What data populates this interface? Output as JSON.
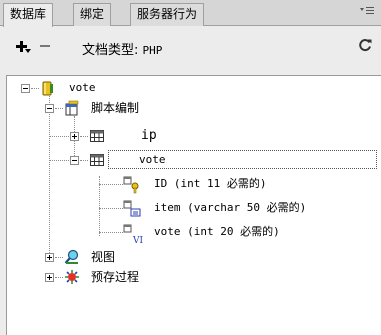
{
  "tabs": [
    {
      "label": "数据库",
      "active": true
    },
    {
      "label": "绑定",
      "active": false
    },
    {
      "label": "服务器行为",
      "active": false
    }
  ],
  "panel_menu_icon": "options-menu-icon",
  "toolbar": {
    "add_icon": "plus-dropdown-icon",
    "remove_icon": "minus-icon",
    "doc_type_label": "文档类型:",
    "doc_type_value": "PHP",
    "refresh_icon": "refresh-icon"
  },
  "tree": {
    "root": {
      "label": "vote",
      "icon": "database-cylinder-icon"
    },
    "scripts": {
      "label": "脚本编制",
      "icon": "table-folder-icon"
    },
    "tables": [
      {
        "label": "ip",
        "icon": "table-grid-icon",
        "expanded": false
      },
      {
        "label": "vote",
        "icon": "table-grid-icon",
        "expanded": true
      }
    ],
    "columns": [
      {
        "label": "ID (int 11 必需的)",
        "icon": "key-column-icon"
      },
      {
        "label": "item (varchar 50 必需的)",
        "icon": "text-column-icon"
      },
      {
        "label": "vote (int 20 必需的)",
        "icon": "int-column-icon"
      }
    ],
    "views": {
      "label": "视图",
      "icon": "view-icon"
    },
    "procedures": {
      "label": "预存过程",
      "icon": "procedure-icon"
    }
  },
  "colors": {
    "panel_bg": "#ececec",
    "tree_bg": "#ffffff",
    "db_yellow": "#e8c21a",
    "column_blue": "#2a3fb0"
  }
}
